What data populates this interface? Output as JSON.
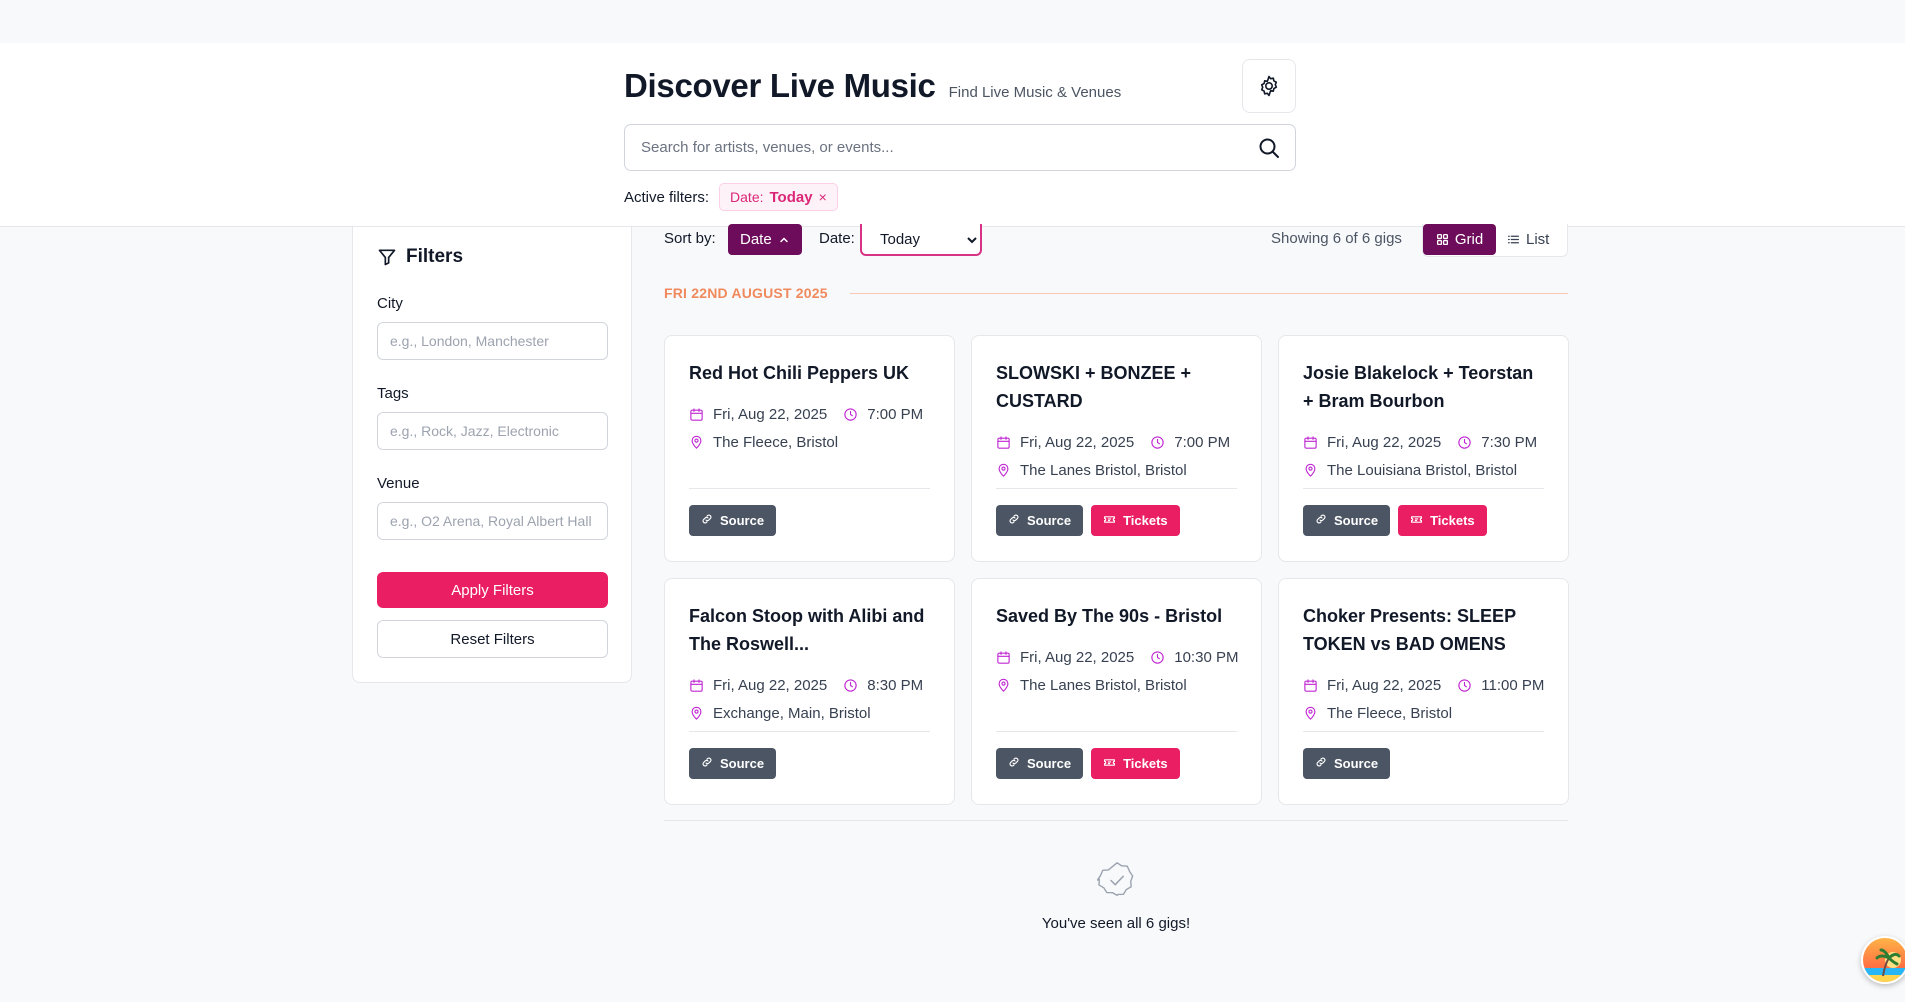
{
  "header": {
    "title": "Discover Live Music",
    "subtitle": "Find Live Music & Venues",
    "search_placeholder": "Search for artists, venues, or events...",
    "active_filters_label": "Active filters:",
    "chip_prefix": "Date:",
    "chip_value": "Today",
    "chip_close": "×"
  },
  "sidebar": {
    "title": "Filters",
    "city_label": "City",
    "city_placeholder": "e.g., London, Manchester",
    "tags_label": "Tags",
    "tags_placeholder": "e.g., Rock, Jazz, Electronic",
    "venue_label": "Venue",
    "venue_placeholder": "e.g., O2 Arena, Royal Albert Hall",
    "apply_label": "Apply Filters",
    "reset_label": "Reset Filters"
  },
  "toolbar": {
    "sort_label": "Sort by:",
    "sort_value": "Date",
    "date_label": "Date:",
    "date_value": "Today",
    "showing": "Showing 6 of 6 gigs",
    "grid_label": "Grid",
    "list_label": "List"
  },
  "date_group": "FRI 22ND AUGUST 2025",
  "gigs": [
    {
      "title": "Red Hot Chili Peppers UK",
      "date": "Fri, Aug 22, 2025",
      "time": "7:00 PM",
      "venue": "The Fleece, Bristol",
      "source": "Source",
      "tickets": ""
    },
    {
      "title": "SLOWSKI + BONZEE + CUSTARD",
      "date": "Fri, Aug 22, 2025",
      "time": "7:00 PM",
      "venue": "The Lanes Bristol, Bristol",
      "source": "Source",
      "tickets": "Tickets"
    },
    {
      "title": "Josie Blakelock + Teorstan + Bram Bourbon",
      "date": "Fri, Aug 22, 2025",
      "time": "7:30 PM",
      "venue": "The Louisiana Bristol, Bristol",
      "source": "Source",
      "tickets": "Tickets"
    },
    {
      "title": "Falcon Stoop with Alibi and The Roswell...",
      "date": "Fri, Aug 22, 2025",
      "time": "8:30 PM",
      "venue": "Exchange, Main, Bristol",
      "source": "Source",
      "tickets": ""
    },
    {
      "title": "Saved By The 90s - Bristol",
      "date": "Fri, Aug 22, 2025",
      "time": "10:30 PM",
      "venue": "The Lanes Bristol, Bristol",
      "source": "Source",
      "tickets": "Tickets"
    },
    {
      "title": "Choker Presents: SLEEP TOKEN vs BAD OMENS",
      "date": "Fri, Aug 22, 2025",
      "time": "11:00 PM",
      "venue": "The Fleece, Bristol",
      "source": "Source",
      "tickets": ""
    }
  ],
  "end_message": "You've seen all 6 gigs!",
  "colors": {
    "accent": "#e91e63",
    "primary": "#6d0c5a",
    "meta_icon": "#c026d3",
    "date_header": "#f08a5d",
    "source_button": "#4b5563"
  }
}
